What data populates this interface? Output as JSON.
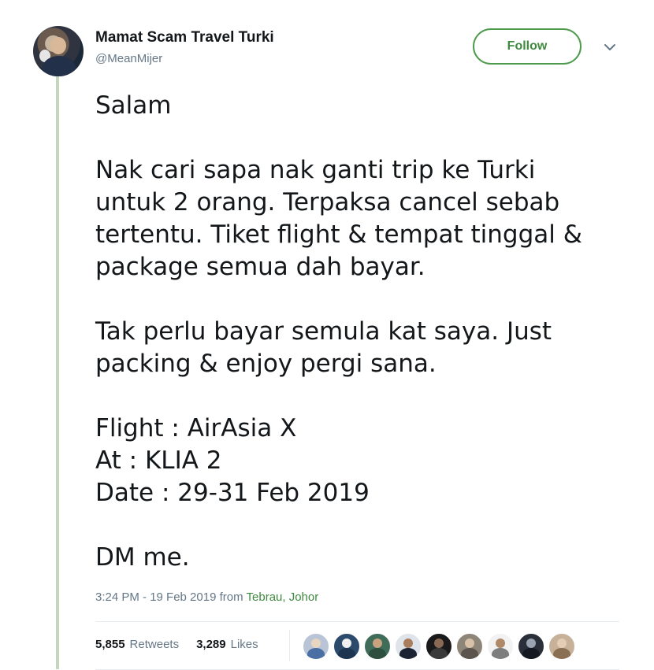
{
  "user": {
    "display_name": "Mamat Scam Travel Turki",
    "handle": "@MeanMijer",
    "avatar_icon": "profile-photo"
  },
  "actions": {
    "follow_label": "Follow",
    "menu_icon": "chevron-down-icon"
  },
  "tweet": {
    "lines": [
      "Salam",
      "",
      "Nak cari sapa nak ganti trip ke Turki",
      "untuk 2 orang. Terpaksa cancel sebab",
      "tertentu. Tiket flight & tempat tinggal &",
      "package semua dah bayar.",
      "",
      "Tak perlu bayar semula kat saya. Just",
      "packing & enjoy pergi sana.",
      "",
      "Flight : AirAsia X",
      "At : KLIA 2",
      "Date : 29-31 Feb 2019",
      "",
      "DM me."
    ]
  },
  "meta": {
    "timestamp": "3:24 PM - 19 Feb 2019",
    "from_label": "from",
    "location": "Tebrau, Johor"
  },
  "stats": {
    "retweets_count": "5,855",
    "retweets_label": "Retweets",
    "likes_count": "3,289",
    "likes_label": "Likes"
  },
  "colors": {
    "accent_green": "#3f8a3e",
    "thread_line": "#c4d6bd",
    "muted_text": "#657786"
  }
}
